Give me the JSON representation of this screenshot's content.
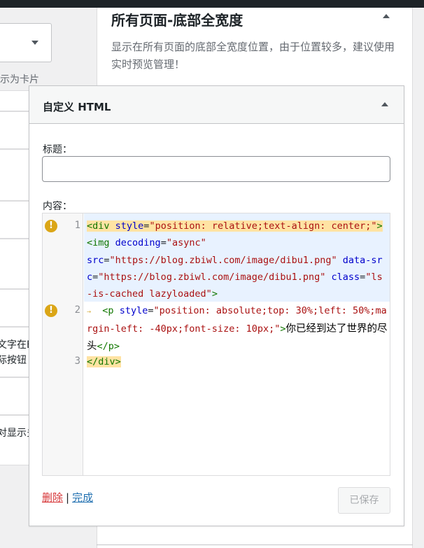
{
  "section": {
    "title": "所有页面-底部全宽度",
    "description": "显示在所有页面的底部全宽度位置，由于位置较多，建议使用实时预览管理！"
  },
  "left": {
    "frag_card": "示为卡片",
    "frag_text1": "文字在E",
    "frag_text2": "际按钮",
    "frag_text3": "对显示多"
  },
  "widget": {
    "title": "自定义 HTML",
    "title_label": "标题：",
    "title_value": "",
    "content_label": "内容：",
    "delete_label": "删除",
    "separator": "|",
    "done_label": "完成",
    "saved_label": "已保存"
  },
  "editor": {
    "warning_symbol": "!",
    "line_numbers": [
      "1",
      "2",
      "3"
    ],
    "line1": {
      "t_div_open": "<div",
      "a_style": "style",
      "eq": "=",
      "s_style": "\"position: relative;text-align: center;\"",
      "t_close": ">",
      "t_img_open": "<img",
      "a_decoding": "decoding",
      "s_decoding": "\"async\"",
      "a_src": "src",
      "s_src": "\"https://blog.zbiwl.com/image/dibu1.png\"",
      "a_data_src": "data-src",
      "s_data_src": "\"https://blog.zbiwl.com/image/dibu1.png\"",
      "a_class": "class",
      "s_class": "\"ls-is-cached lazyloaded\""
    },
    "line2": {
      "indent": "→",
      "t_p_open": "<p",
      "a_style": "style",
      "s_style": "\"position: absolute;top: 30%;left: 50%;margin-left: -40px;font-size: 10px;\"",
      "text": "你已经到达了世界的尽头",
      "t_p_close": "</p>"
    },
    "line3": {
      "t_div_close": "</div>"
    }
  }
}
